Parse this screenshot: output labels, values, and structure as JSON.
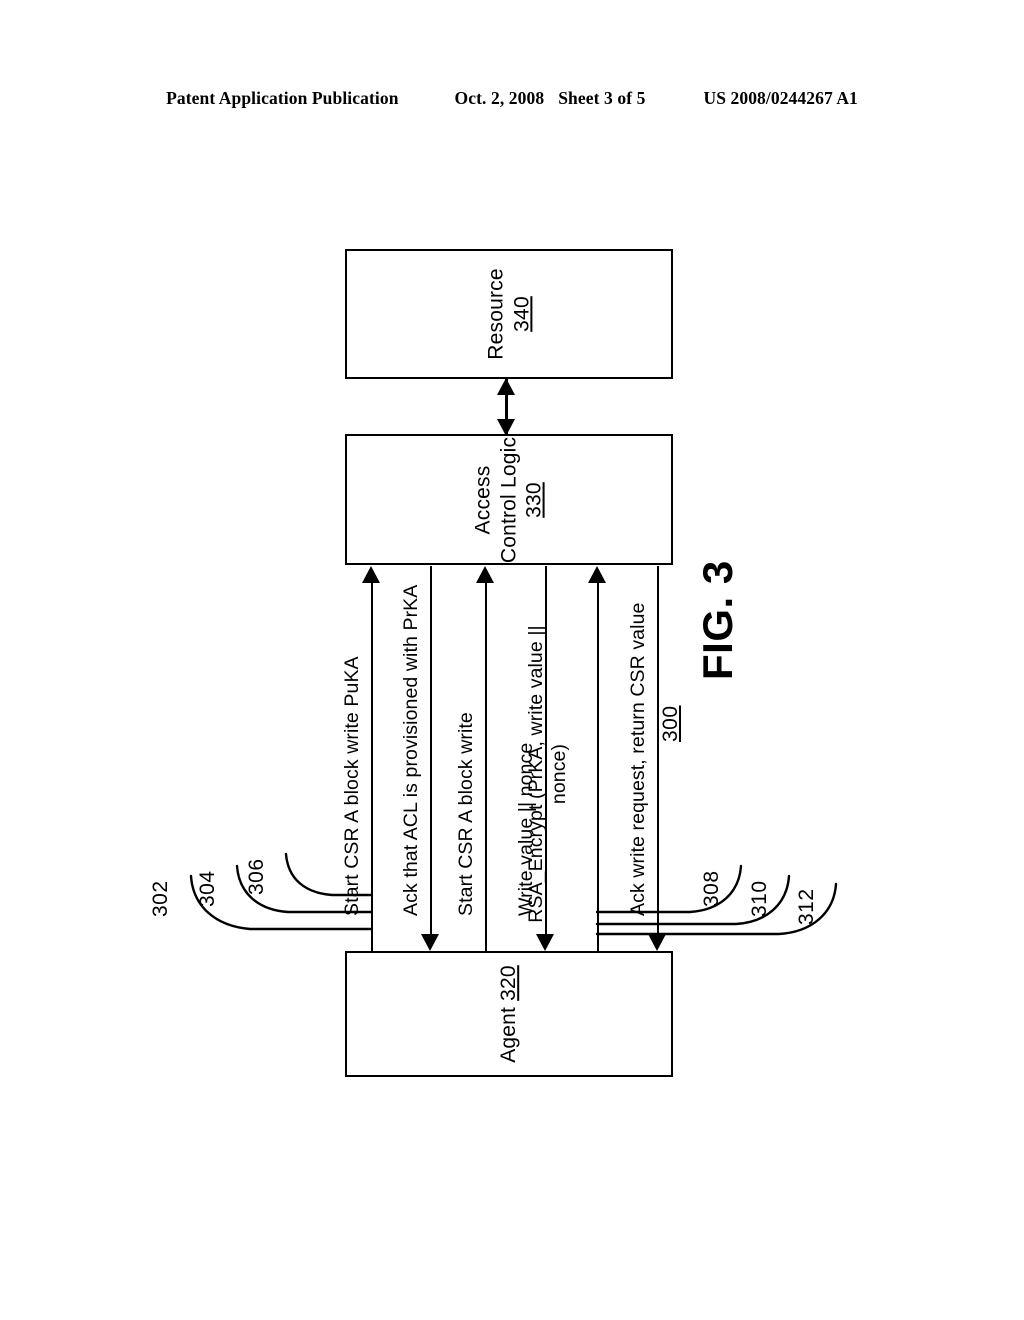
{
  "header": {
    "publication": "Patent Application Publication",
    "date": "Oct. 2, 2008",
    "sheet": "Sheet 3 of 5",
    "patent_number": "US 2008/0244267 A1"
  },
  "figure": {
    "caption": "FIG. 3",
    "figure_number": "300"
  },
  "chart_data": {
    "type": "diagram",
    "title": "FIG. 3",
    "diagram_number": "300",
    "nodes": [
      {
        "id": "resource",
        "label": "Resource",
        "number": "340"
      },
      {
        "id": "acl",
        "label_line1": "Access",
        "label_line2": "Control Logic",
        "number": "330"
      },
      {
        "id": "agent",
        "label": "Agent",
        "number": "320"
      }
    ],
    "links": [
      {
        "from": "acl",
        "to": "resource",
        "direction": "bidirectional",
        "label": ""
      }
    ],
    "messages": [
      {
        "ref": "302",
        "from": "agent",
        "to": "acl",
        "direction": "up",
        "label": "Start CSR A block write PuKA"
      },
      {
        "ref": "304",
        "from": "acl",
        "to": "agent",
        "direction": "down",
        "label": "Ack that ACL is provisioned with PrKA"
      },
      {
        "ref": "306",
        "from": "agent",
        "to": "acl",
        "direction": "up",
        "label": "Start CSR A block write"
      },
      {
        "ref": "308",
        "from": "acl",
        "to": "agent",
        "direction": "down",
        "label": "Write value || nonce"
      },
      {
        "ref": "310",
        "from": "agent",
        "to": "acl",
        "direction": "up",
        "label_line1": "RSA_Encrypt (PrKA, write value ||",
        "label_line2": "nonce)"
      },
      {
        "ref": "312",
        "from": "acl",
        "to": "agent",
        "direction": "down",
        "label": "Ack write request, return CSR value"
      }
    ]
  },
  "boxes": {
    "resource": {
      "label": "Resource",
      "number": "340"
    },
    "acl": {
      "label_line1": "Access",
      "label_line2": "Control Logic",
      "number": "330"
    },
    "agent": {
      "label": "Agent",
      "number": "320"
    }
  },
  "messages": {
    "m302": {
      "ref": "302",
      "label": "Start CSR A block write PuKA"
    },
    "m304": {
      "ref": "304",
      "label": "Ack that ACL is provisioned with PrKA"
    },
    "m306": {
      "ref": "306",
      "label": "Start CSR A block write"
    },
    "m308": {
      "ref": "308",
      "label": "Write value || nonce"
    },
    "m310": {
      "ref": "310",
      "label_line1": "RSA_Encrypt (PrKA, write value ||",
      "label_line2": "nonce)"
    },
    "m312": {
      "ref": "312",
      "label": "Ack write request, return CSR value"
    }
  },
  "colors": {
    "ink": "#000000",
    "paper": "#ffffff"
  }
}
